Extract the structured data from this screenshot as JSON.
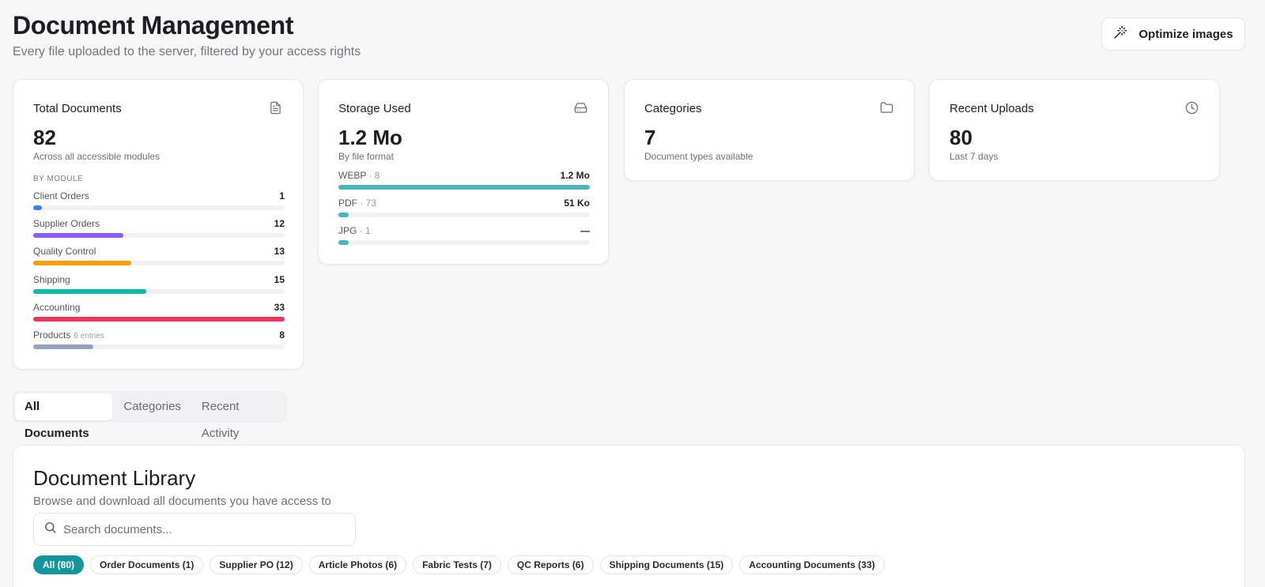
{
  "header": {
    "title": "Document Management",
    "subtitle": "Every file uploaded to the server, filtered by your access rights",
    "optimize_label": "Optimize images"
  },
  "cards": {
    "total": {
      "title": "Total Documents",
      "icon": "file-text-icon",
      "value": "82",
      "caption": "Across all accessible modules",
      "section_label": "BY MODULE",
      "modules": [
        {
          "label": "Client Orders",
          "sub": "",
          "value": "1",
          "fraction": 0.03,
          "color": "#3b82f6"
        },
        {
          "label": "Supplier Orders",
          "sub": "",
          "value": "12",
          "fraction": 0.36,
          "color": "#8b5cf6"
        },
        {
          "label": "Quality Control",
          "sub": "",
          "value": "13",
          "fraction": 0.39,
          "color": "#f59e0b"
        },
        {
          "label": "Shipping",
          "sub": "",
          "value": "15",
          "fraction": 0.45,
          "color": "#14b8a6"
        },
        {
          "label": "Accounting",
          "sub": "",
          "value": "33",
          "fraction": 1.0,
          "color": "#e8385a"
        },
        {
          "label": "Products",
          "sub": "6 entries",
          "value": "8",
          "fraction": 0.24,
          "color": "#94a3b8"
        }
      ]
    },
    "storage": {
      "title": "Storage Used",
      "icon": "hard-drive-icon",
      "value": "1.2 Mo",
      "caption": "By file format",
      "formats": [
        {
          "label": "WEBP",
          "count": "8",
          "value": "1.2 Mo",
          "fraction": 1.0,
          "color": "#4fb3b7"
        },
        {
          "label": "PDF",
          "count": "73",
          "value": "51 Ko",
          "fraction": 0.04,
          "color": "#4fb3b7"
        },
        {
          "label": "JPG",
          "count": "1",
          "value": "—",
          "fraction": 0.04,
          "color": "#4fb3b7"
        }
      ]
    },
    "categories": {
      "title": "Categories",
      "icon": "folder-icon",
      "value": "7",
      "caption": "Document types available"
    },
    "recent": {
      "title": "Recent Uploads",
      "icon": "clock-icon",
      "value": "80",
      "caption": "Last 7 days"
    }
  },
  "tabs": [
    "All Documents",
    "Categories",
    "Recent Activity"
  ],
  "library": {
    "title": "Document Library",
    "subtitle": "Browse and download all documents you have access to",
    "search_placeholder": "Search documents...",
    "chips": [
      "All (80)",
      "Order Documents (1)",
      "Supplier PO (12)",
      "Article Photos (6)",
      "Fabric Tests (7)",
      "QC Reports (6)",
      "Shipping Documents (15)",
      "Accounting Documents (33)"
    ]
  }
}
